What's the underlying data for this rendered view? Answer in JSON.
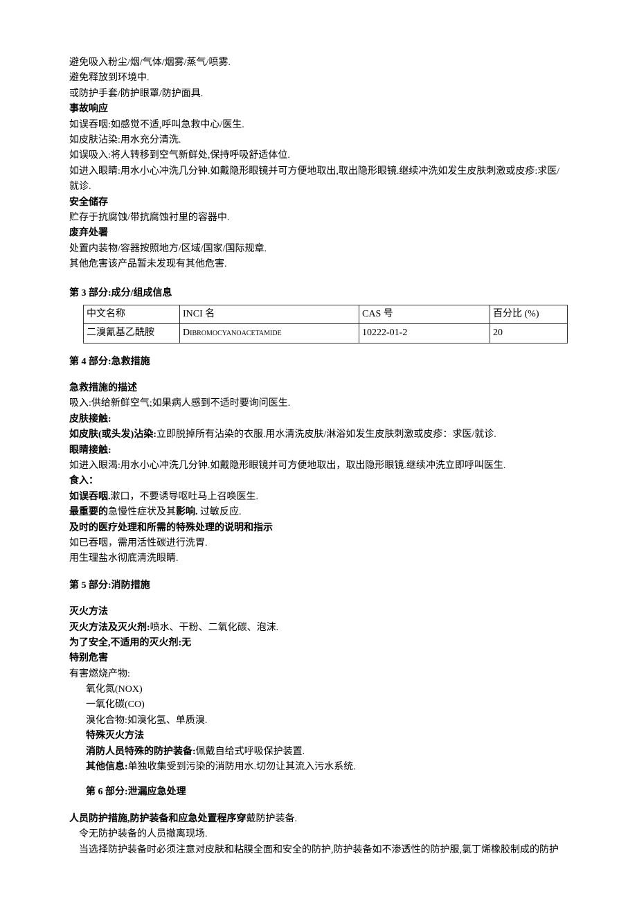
{
  "intro_lines": [
    "避免吸入粉尘/烟/气体/烟雾/蒸气/喷雾.",
    "避免释放到环境中.",
    "或防护手套/防护眼罩/防护面具."
  ],
  "accident_response": {
    "title": "事故响应",
    "lines": [
      "如误吞咽:如感觉不适,呼叫急救中心/医生.",
      "如皮肤沾染:用水充分清洗.",
      "如误吸入:将人转移到空气新鲜处,保持呼吸舒适体位.",
      "如进入眼睛:用水小心冲洗几分钟.如戴隐形眼镜并可方便地取出,取出隐形眼镜.继续冲洗如发生皮肤刺激或皮疹:求医/就诊."
    ]
  },
  "safe_storage": {
    "title": "安全储存",
    "line": "贮存于抗腐蚀/带抗腐蚀衬里的容器中."
  },
  "disposal": {
    "title": "废弃处署",
    "lines": [
      "处置内装物/容器按照地方/区域/国家/国际规章.",
      "其他危害该产品暂未发现有其他危害."
    ]
  },
  "section3": {
    "title": "第 3 部分:成分/组成信息",
    "table": {
      "header": [
        "中文名称",
        "INCI 名",
        "CAS 号",
        "百分比 (%)"
      ],
      "row": [
        "二溴氰基乙酰胺",
        "Dibromocyanoacetamide",
        "10222-01-2",
        "20"
      ]
    }
  },
  "section4": {
    "title": "第 4 部分:急救措施",
    "desc_title": "急救措施的描述",
    "inhalation": "吸入:供给新鲜空气;如果病人感到不适时要询问医生.",
    "skin_title": "皮肤接触:",
    "skin_line_prefix": "如皮肤(或头发)沾染:",
    "skin_line_rest": "立即脱掉所有沾染的衣服.用水清洗皮肤/淋浴如发生皮肤刺激或皮疹：求医/就诊.",
    "eye_title": "眼睛接触:",
    "eye_line": "如进入眼渴:用水小心冲洗几分钟.如戴隐形眼镜并可方便地取出，取出隐形眼镜.继续冲洗立即呼叫医生.",
    "ingest_title": "食入：",
    "ingest_prefix": "如误吞咽.",
    "ingest_rest": "漱口，不要诱导呕吐马上召唤医生.",
    "symptoms_prefix_b1": "最重要的",
    "symptoms_mid1": "急慢性症状及其",
    "symptoms_b2": "影响.",
    "symptoms_end": " 过敏反应.",
    "treatment_prefix": "及时的",
    "treatment_mid1": "医疗处理和所",
    "treatment_b2": "需的特",
    "treatment_mid2": "殊处理的说明和指示",
    "treatment_lines": [
      "如已吞咽，需用活性碳进行洗胃.",
      "用生理盐水彻底清洗眼睛."
    ]
  },
  "section5": {
    "title": "第 5 部分:消防措施",
    "method_title": "灭火方法",
    "method_prefix": "灭火方法及灭火剂:",
    "method_rest": "喷水、干粉、二氧化碳、泡沫.",
    "unsuitable_prefix": "为了",
    "unsuitable_mid": "安全,不适用的",
    "unsuitable_rest": "灭火剂:无",
    "hazard_title": "特别危害",
    "hazard_line": "有害燃烧产物:",
    "hazard_items": [
      "氧化氮(NOX)",
      "一氧化碳(CO)",
      "溴化合物:如溴化氢、单质溴."
    ],
    "special_method": "特殊灭火方法",
    "equipment_prefix": "消防人员特殊的",
    "equipment_mid": "防护装备:",
    "equipment_rest": "佩戴自给式呼吸保护装置.",
    "other_prefix": "其他信息:",
    "other_rest": "单独收集受到污染的消防用水.切勿让其流入污水系统."
  },
  "section6": {
    "title": "第 6 部分:泄漏应急处理",
    "p1_prefix": "人员防护措施,防护装",
    "p1_mid": "备和应急处置程序穿",
    "p1_rest": "戴防护装备.",
    "lines": [
      "令无防护装备的人员撤离现场.",
      "当选择防护装备时必须注意对皮肤和粘膜全面和安全的防护,防护装备如不渗透性的防护服,氯丁烯橡胶制成的防护"
    ]
  }
}
